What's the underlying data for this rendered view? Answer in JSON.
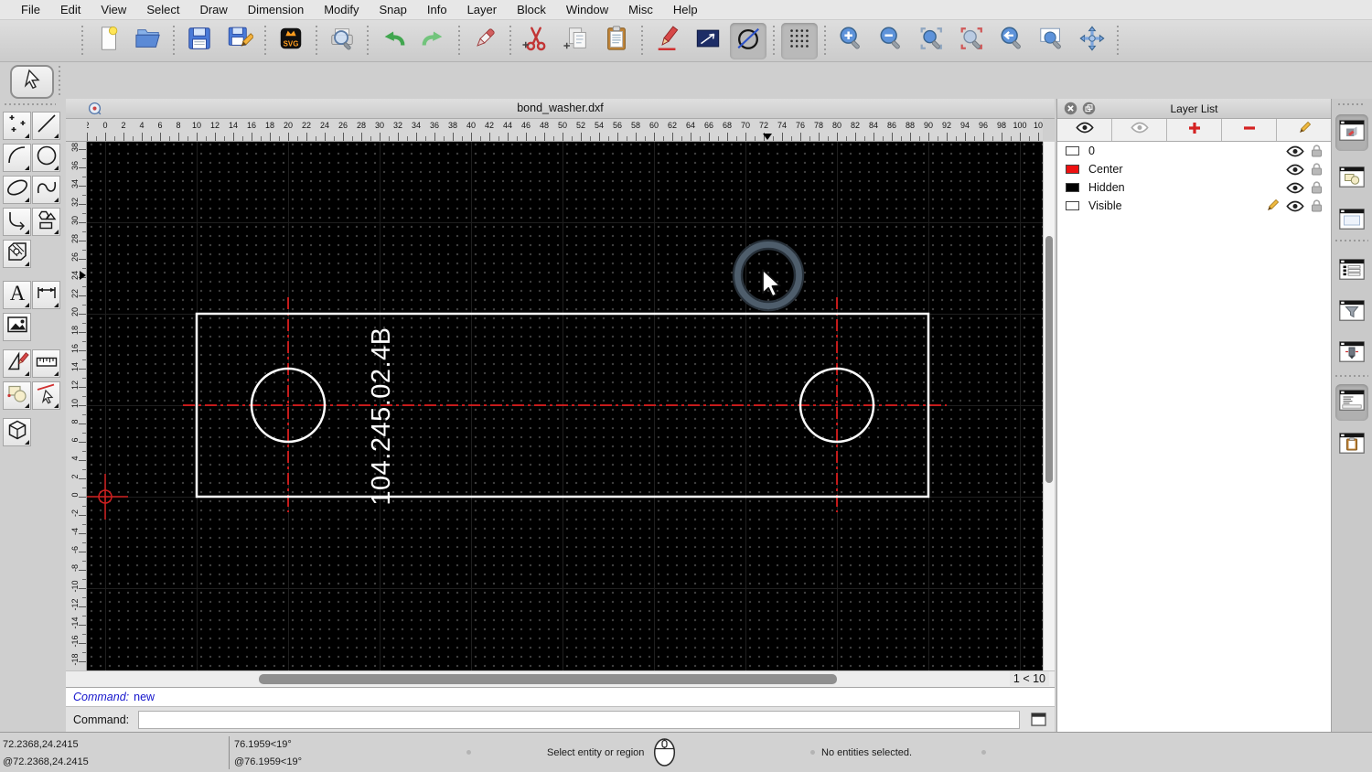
{
  "menu": {
    "items": [
      "File",
      "Edit",
      "View",
      "Select",
      "Draw",
      "Dimension",
      "Modify",
      "Snap",
      "Info",
      "Layer",
      "Block",
      "Window",
      "Misc",
      "Help"
    ]
  },
  "window": {
    "title": "bond_washer.dxf"
  },
  "toolbar": {
    "groups": [
      [
        "new-file",
        "open-file"
      ],
      [
        "save",
        "save-as"
      ],
      [
        "export-svg"
      ],
      [
        "print-preview"
      ],
      [
        "undo",
        "redo"
      ],
      [
        "delete"
      ],
      [
        "cut",
        "copy",
        "paste"
      ],
      [
        "draw-pen",
        "line-tool",
        "circle-tool"
      ],
      [
        "grid-toggle"
      ],
      [
        "zoom-in",
        "zoom-out",
        "zoom-auto",
        "zoom-current",
        "zoom-previous",
        "zoom-window",
        "zoom-pan"
      ]
    ],
    "pressed": [
      "circle-tool",
      "grid-toggle"
    ]
  },
  "left_toolbar": {
    "select_tool": "select-arrow",
    "rows": [
      [
        "points",
        "line"
      ],
      [
        "arc",
        "circle"
      ],
      [
        "ellipse",
        "spline"
      ],
      [
        "polyline",
        "polygon"
      ],
      [
        "hatch"
      ],
      [
        "text",
        "dimension"
      ],
      [
        "image"
      ],
      [
        "modify",
        "measure"
      ],
      [
        "order",
        "explode"
      ],
      [
        "solid-3d"
      ]
    ]
  },
  "rulers": {
    "h_labels": [
      "2",
      "0",
      "2",
      "4",
      "6",
      "8",
      "10",
      "12",
      "14",
      "16",
      "18",
      "20",
      "22",
      "24",
      "26",
      "28",
      "30",
      "32",
      "34",
      "36",
      "38",
      "40",
      "42",
      "44",
      "46",
      "48",
      "50",
      "52",
      "54",
      "56",
      "58",
      "60",
      "62",
      "64",
      "66",
      "68",
      "70",
      "72",
      "74",
      "76",
      "78",
      "80",
      "82",
      "84",
      "86",
      "88",
      "90",
      "92",
      "94",
      "96",
      "98",
      "100",
      "10"
    ],
    "v_labels": [
      "38",
      "36",
      "34",
      "32",
      "30",
      "28",
      "26",
      "24",
      "22",
      "20",
      "18",
      "16",
      "14",
      "12",
      "10",
      "8",
      "6",
      "4",
      "2",
      "0",
      "-2",
      "-4",
      "-6",
      "-8",
      "-10",
      "-12",
      "-14",
      "-16",
      "-18"
    ]
  },
  "canvas": {
    "zoom_indicator": "1 < 10"
  },
  "drawing": {
    "part_label": "104.245.02.4B",
    "colors": {
      "outline": "#ffffff",
      "centerline": "#ff1f1f",
      "origin": "#cf1f1f"
    }
  },
  "layer_panel": {
    "title": "Layer List",
    "toolbar": [
      "show-all-eye",
      "hide-all-eye",
      "add-layer",
      "remove-layer",
      "edit-layer"
    ],
    "layers": [
      {
        "name": "0",
        "swatch": "#ffffff",
        "current": false
      },
      {
        "name": "Center",
        "swatch": "#ee1111",
        "current": false
      },
      {
        "name": "Hidden",
        "swatch": "#000000",
        "current": false
      },
      {
        "name": "Visible",
        "swatch": "#ffffff",
        "current": true
      }
    ]
  },
  "right_dock": {
    "buttons": [
      "dock-draw",
      "dock-blocks",
      "dock-library",
      "dock-layers",
      "dock-filter",
      "dock-pen",
      "dock-command",
      "dock-clipboard"
    ],
    "pressed": [
      0,
      6
    ]
  },
  "command": {
    "history_label": "Command:",
    "history_value": "new",
    "prompt_label": "Command:",
    "input_value": ""
  },
  "statusbar": {
    "abs": "72.2368,24.2415",
    "rel": "@72.2368,24.2415",
    "polar": "76.1959<19°",
    "polar_rel": "@76.1959<19°",
    "hint": "Select entity or region",
    "selection": "No entities selected."
  }
}
